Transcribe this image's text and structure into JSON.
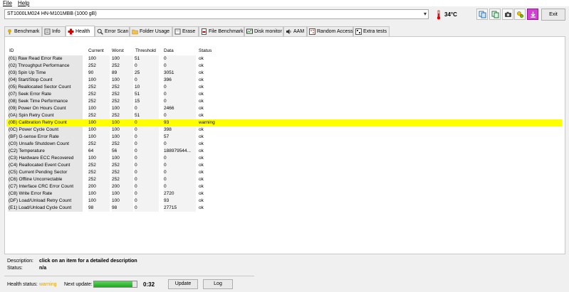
{
  "menu": {
    "file": "File",
    "help": "Help"
  },
  "device": {
    "name": "ST1000LM024 HN-M101MBB (1000 gB)"
  },
  "temperature": "34°C",
  "toolbar": {
    "exit_label": "Exit"
  },
  "tabs": [
    {
      "label": "Benchmark"
    },
    {
      "label": "Info"
    },
    {
      "label": "Health"
    },
    {
      "label": "Error Scan"
    },
    {
      "label": "Folder Usage"
    },
    {
      "label": "Erase"
    },
    {
      "label": "File Benchmark"
    },
    {
      "label": "Disk monitor"
    },
    {
      "label": "AAM"
    },
    {
      "label": "Random Access"
    },
    {
      "label": "Extra tests"
    }
  ],
  "table": {
    "headers": {
      "id": "ID",
      "current": "Current",
      "worst": "Worst",
      "threshold": "Threshold",
      "data": "Data",
      "status": "Status"
    },
    "rows": [
      {
        "id": "(01) Raw Read Error Rate",
        "current": "100",
        "worst": "100",
        "threshold": "51",
        "data": "0",
        "status": "ok"
      },
      {
        "id": "(02) Throughput Performance",
        "current": "252",
        "worst": "252",
        "threshold": "0",
        "data": "0",
        "status": "ok"
      },
      {
        "id": "(03) Spin Up Time",
        "current": "90",
        "worst": "89",
        "threshold": "25",
        "data": "3051",
        "status": "ok"
      },
      {
        "id": "(04) Start/Stop Count",
        "current": "100",
        "worst": "100",
        "threshold": "0",
        "data": "396",
        "status": "ok"
      },
      {
        "id": "(05) Reallocated Sector Count",
        "current": "252",
        "worst": "252",
        "threshold": "10",
        "data": "0",
        "status": "ok"
      },
      {
        "id": "(07) Seek Error Rate",
        "current": "252",
        "worst": "252",
        "threshold": "51",
        "data": "0",
        "status": "ok"
      },
      {
        "id": "(08) Seek Time Performance",
        "current": "252",
        "worst": "252",
        "threshold": "15",
        "data": "0",
        "status": "ok"
      },
      {
        "id": "(09) Power On Hours Count",
        "current": "100",
        "worst": "100",
        "threshold": "0",
        "data": "2466",
        "status": "ok"
      },
      {
        "id": "(0A) Spin Retry Count",
        "current": "252",
        "worst": "252",
        "threshold": "51",
        "data": "0",
        "status": "ok"
      },
      {
        "id": "(0B) Calibration Retry Count",
        "current": "100",
        "worst": "100",
        "threshold": "0",
        "data": "93",
        "status": "warning"
      },
      {
        "id": "(0C) Power Cycle Count",
        "current": "100",
        "worst": "100",
        "threshold": "0",
        "data": "398",
        "status": "ok"
      },
      {
        "id": "(BF) G-sense Error Rate",
        "current": "100",
        "worst": "100",
        "threshold": "0",
        "data": "57",
        "status": "ok"
      },
      {
        "id": "(C0) Unsafe Shutdown Count",
        "current": "252",
        "worst": "252",
        "threshold": "0",
        "data": "0",
        "status": "ok"
      },
      {
        "id": "(C2) Temperature",
        "current": "64",
        "worst": "56",
        "threshold": "0",
        "data": "188979544...",
        "status": "ok"
      },
      {
        "id": "(C3) Hardware ECC Recovered",
        "current": "100",
        "worst": "100",
        "threshold": "0",
        "data": "0",
        "status": "ok"
      },
      {
        "id": "(C4) Reallocated Event Count",
        "current": "252",
        "worst": "252",
        "threshold": "0",
        "data": "0",
        "status": "ok"
      },
      {
        "id": "(C5) Current Pending Sector",
        "current": "252",
        "worst": "252",
        "threshold": "0",
        "data": "0",
        "status": "ok"
      },
      {
        "id": "(C6) Offline Uncorrectable",
        "current": "252",
        "worst": "252",
        "threshold": "0",
        "data": "0",
        "status": "ok"
      },
      {
        "id": "(C7) Interface CRC Error Count",
        "current": "200",
        "worst": "200",
        "threshold": "0",
        "data": "0",
        "status": "ok"
      },
      {
        "id": "(C8) Write Error Rate",
        "current": "100",
        "worst": "100",
        "threshold": "0",
        "data": "2720",
        "status": "ok"
      },
      {
        "id": "(DF) Load/Unload Retry Count",
        "current": "100",
        "worst": "100",
        "threshold": "0",
        "data": "93",
        "status": "ok"
      },
      {
        "id": "(E1) Load/Unload Cycle Count",
        "current": "98",
        "worst": "98",
        "threshold": "0",
        "data": "27715",
        "status": "ok"
      }
    ]
  },
  "description": {
    "label": "Description:",
    "value": "click on an item for a detailed description",
    "status_label": "Status:",
    "status_value": "n/a"
  },
  "statusbar": {
    "health_label": "Health status:",
    "health_value": "warning",
    "next_update_label": "Next update:",
    "progress": 0.9,
    "countdown": "0:32",
    "update_label": "Update",
    "log_label": "Log"
  },
  "colors": {
    "warning_row": "#ffff00",
    "health_warning": "#d9a400",
    "progress_fill": "#2fb82f"
  },
  "icons": [
    "thermometer-icon",
    "copy-icon",
    "copy-text-icon",
    "camera-icon",
    "options-icon",
    "download-icon",
    "health-cross-icon"
  ]
}
